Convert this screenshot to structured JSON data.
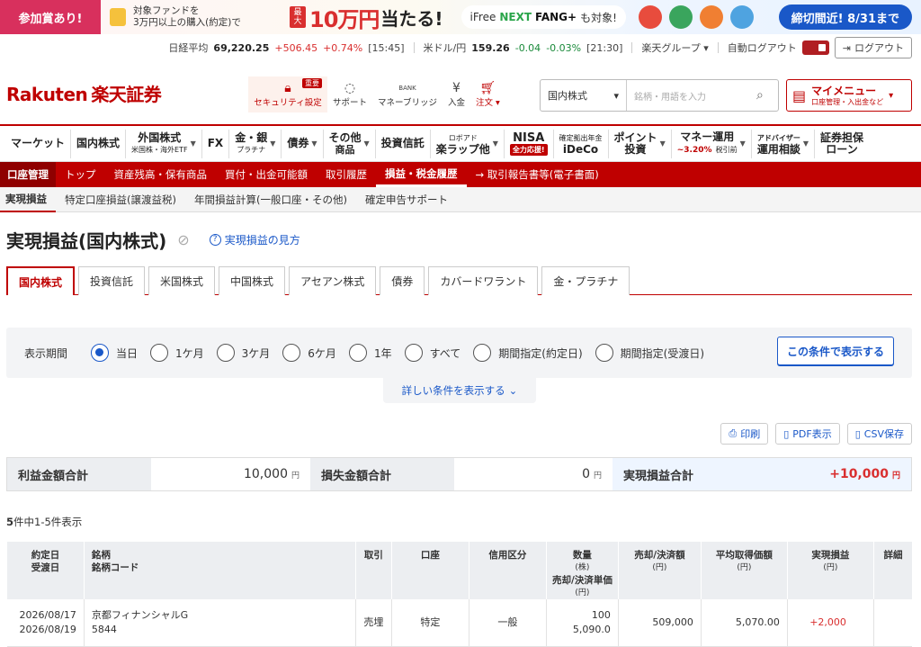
{
  "banner": {
    "left": "参加賞あり!",
    "text_line1": "対象ファンドを",
    "text_line2": "3万円以上の購入(約定)で",
    "max_label": "最大",
    "big_amount": "10万円",
    "big_suffix": "当たる!",
    "fund_prefix": "iFree",
    "fund_next": "NEXT",
    "fund_name": "FANG+",
    "fund_suffix": "も対象!",
    "cta": "締切間近! 8/31まで"
  },
  "ticker": {
    "nikkei_label": "日経平均",
    "nikkei_value": "69,220.25",
    "nikkei_change": "+506.45",
    "nikkei_pct": "+0.74%",
    "nikkei_time": "[15:45]",
    "usd_label": "米ドル/円",
    "usd_value": "159.26",
    "usd_change": "-0.04",
    "usd_pct": "-0.03%",
    "usd_time": "[21:30]",
    "group": "楽天グループ",
    "auto_logout": "自動ログアウト",
    "logout": "ログアウト"
  },
  "header": {
    "logo_en": "Rakuten",
    "logo_jp": "楽天証券",
    "tools": [
      {
        "label": "セキュリティ設定",
        "badge": "重要"
      },
      {
        "label": "サポート"
      },
      {
        "label": "マネーブリッジ",
        "icon_text": "BANK"
      },
      {
        "label": "入金"
      },
      {
        "label": "注文"
      }
    ],
    "search_select": "国内株式",
    "search_placeholder": "銘柄・用語を入力",
    "mymenu_title": "マイメニュー",
    "mymenu_sub": "口座管理・入出金など"
  },
  "gnav": [
    {
      "label": "マーケット"
    },
    {
      "label": "国内株式"
    },
    {
      "label": "外国株式",
      "sub": "米国株・海外ETF"
    },
    {
      "label": "FX"
    },
    {
      "label": "金・銀",
      "sub": "プラチナ"
    },
    {
      "label": "債券"
    },
    {
      "label": "その他",
      "sub": "商品"
    },
    {
      "label": "投資信託"
    },
    {
      "label": "楽ラップ他",
      "sub_top": "ロボアド"
    },
    {
      "label": "NISA",
      "badge": "全力応援!"
    },
    {
      "label": "iDeCo",
      "sub_top": "確定拠出年金"
    },
    {
      "label": "ポイント",
      "sub": "投資"
    },
    {
      "label": "マネー運用",
      "sub_red": "~3.20%",
      "sub_tail": "税引前"
    },
    {
      "label": "アドバイザー",
      "sub": "運用相談"
    },
    {
      "label": "証券担保",
      "sub": "ローン"
    }
  ],
  "redbar": {
    "account": "口座管理",
    "items": [
      "トップ",
      "資産残高・保有商品",
      "買付・出金可能額",
      "取引履歴",
      "損益・税金履歴",
      "取引報告書等(電子書面)"
    ]
  },
  "subnav": [
    "実現損益",
    "特定口座損益(譲渡益税)",
    "年間損益計算(一般口座・その他)",
    "確定申告サポート"
  ],
  "page": {
    "title": "実現損益(国内株式)",
    "help": "実現損益の見方"
  },
  "tabs": [
    "国内株式",
    "投資信託",
    "米国株式",
    "中国株式",
    "アセアン株式",
    "債券",
    "カバードワラント",
    "金・プラチナ"
  ],
  "filter": {
    "label": "表示期間",
    "options": [
      "当日",
      "1ケ月",
      "3ケ月",
      "6ケ月",
      "1年",
      "すべて",
      "期間指定(約定日)",
      "期間指定(受渡日)"
    ],
    "selected": 0,
    "apply": "この条件で表示する",
    "more": "詳しい条件を表示する"
  },
  "actions": [
    "印刷",
    "PDF表示",
    "CSV保存"
  ],
  "summary": {
    "profit_label": "利益金額合計",
    "profit_value": "10,000",
    "loss_label": "損失金額合計",
    "loss_value": "0",
    "realized_label": "実現損益合計",
    "realized_value": "+10,000",
    "unit": "円"
  },
  "count": {
    "total": "5",
    "text": "件中1-5件表示"
  },
  "table": {
    "headers": {
      "date1": "約定日",
      "date2": "受渡日",
      "name1": "銘柄",
      "name2": "銘柄コード",
      "trade": "取引",
      "account": "口座",
      "credit": "信用区分",
      "qty": "数量",
      "qty_unit": "(株)",
      "price": "売却/決済単価",
      "price_unit": "(円)",
      "amount": "売却/決済額",
      "amount_unit": "(円)",
      "avg": "平均取得価額",
      "avg_unit": "(円)",
      "pl": "実現損益",
      "pl_unit": "(円)",
      "detail": "詳細"
    },
    "rows": [
      {
        "trade_date": "2026/08/17",
        "settle_date": "2026/08/19",
        "name": "京都フィナンシャルG",
        "code": "5844",
        "trade": "売埋",
        "account": "特定",
        "credit": "一般",
        "qty": "100",
        "price": "5,090.0",
        "amount": "509,000",
        "avg": "5,070.00",
        "pl": "+2,000"
      }
    ]
  }
}
